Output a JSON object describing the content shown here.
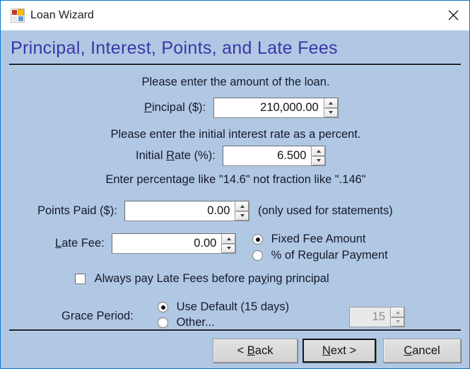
{
  "window": {
    "title": "Loan Wizard",
    "icon": "app-tiles-icon",
    "close_label": "✕",
    "border_color": "#0c79d0",
    "body_bg": "#b0c8e4"
  },
  "header": {
    "wizard_title": "Principal, Interest, Points, and Late Fees",
    "title_color": "#3b36a8"
  },
  "principal": {
    "prompt": "Please enter the amount of the loan.",
    "label_pre": "P",
    "label_accel": "r",
    "label_post": "incipal ($):",
    "label_full": "Principal ($):",
    "value": "210,000.00"
  },
  "rate": {
    "prompt": "Please enter the initial interest rate as a percent.",
    "label_pre": "Initial ",
    "label_accel": "R",
    "label_post": "ate (%):",
    "label_full": "Initial Rate (%):",
    "value": "6.500",
    "hint": "Enter percentage like \"14.6\" not fraction like \".146\""
  },
  "points": {
    "label": "Points Paid ($):",
    "value": "0.00",
    "note": "(only used for statements)"
  },
  "late_fee": {
    "label_pre": "",
    "label_accel": "L",
    "label_post": "ate Fee:",
    "label_full": "Late Fee:",
    "value": "0.00",
    "options": [
      {
        "label": "Fixed Fee Amount",
        "selected": true
      },
      {
        "label": "% of Regular Payment",
        "selected": false
      }
    ],
    "checkbox": {
      "pre": "Always pay Late Fees before pa",
      "accel": "y",
      "post": "ing principal",
      "full": "Always pay Late Fees before paying principal",
      "checked": false
    }
  },
  "grace_period": {
    "label": "Grace Period:",
    "options": [
      {
        "label": "Use Default (15 days)",
        "selected": true
      },
      {
        "label": "Other...",
        "selected": false
      }
    ],
    "value": "15",
    "disabled": true
  },
  "footer": {
    "back": {
      "pre": "< ",
      "accel": "B",
      "post": "ack",
      "full": "< Back"
    },
    "next": {
      "pre": "",
      "accel": "N",
      "post": "ext >",
      "full": "Next >",
      "is_default": true
    },
    "cancel": {
      "pre": "",
      "accel": "C",
      "post": "ancel",
      "full": "Cancel"
    }
  }
}
